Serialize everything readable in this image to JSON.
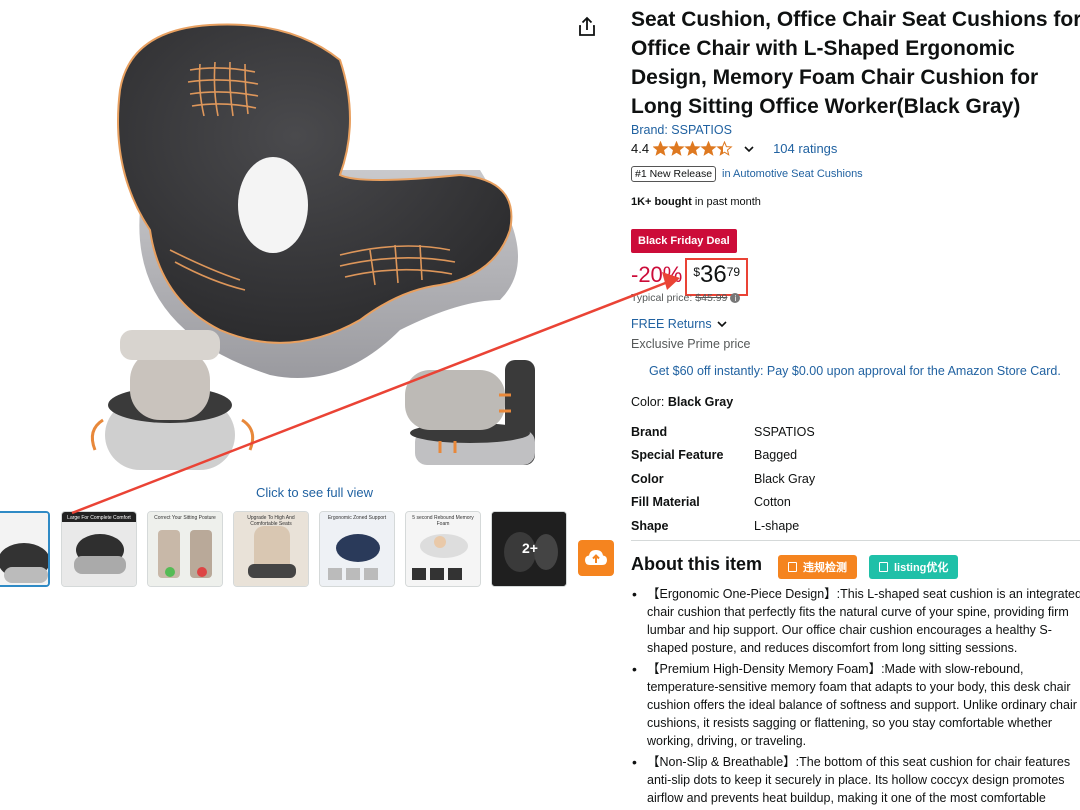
{
  "product": {
    "title": "Seat Cushion, Office Chair Seat Cushions for Office Chair with L-Shaped Ergonomic Design, Memory Foam Chair Cushion for Long Sitting Office Worker(Black Gray)",
    "brand_link": "Brand: SSPATIOS",
    "rating": "4.4",
    "stars": 4.4,
    "ratings_count": "104 ratings",
    "new_release_badge": "#1 New Release",
    "new_release_category": "in Automotive Seat Cushions",
    "bought_bold": "1K+ bought",
    "bought_rest": " in past month"
  },
  "pricing": {
    "deal_badge": "Black Friday Deal",
    "discount": "-20%",
    "currency": "$",
    "whole": "36",
    "fraction": "79",
    "typical_label": "Typical price:",
    "typical_value": "$45.99",
    "free_returns": "FREE Returns",
    "prime_price": "Exclusive Prime price",
    "store_card": "Get $60 off instantly: Pay $0.00 upon approval for the Amazon Store Card."
  },
  "color": {
    "label": "Color:",
    "value": "Black Gray"
  },
  "specs": [
    {
      "key": "Brand",
      "value": "SSPATIOS"
    },
    {
      "key": "Special Feature",
      "value": "Bagged"
    },
    {
      "key": "Color",
      "value": "Black Gray"
    },
    {
      "key": "Fill Material",
      "value": "Cotton"
    },
    {
      "key": "Shape",
      "value": "L-shape"
    }
  ],
  "gallery": {
    "click_full_view": "Click to see full view",
    "thumb_captions": [
      "",
      "Large For Complete Comfort",
      "Correct Your Sitting Posture",
      "Upgrade To High And Comfortable Seats",
      "Ergonomic Zoned Support",
      "5 second Rebound Memory Foam",
      ""
    ],
    "more_label": "2+"
  },
  "about": {
    "title": "About this item",
    "tool_violation": "违规检测",
    "tool_listing": "listing优化",
    "bullets": [
      "【Ergonomic One-Piece Design】:This L-shaped seat cushion is an integrated chair cushion that perfectly fits the natural curve of your spine, providing firm lumbar and hip support. Our office chair cushion encourages a healthy S-shaped posture, and reduces discomfort from long sitting sessions.",
      "【Premium High-Density Memory Foam】:Made with slow-rebound, temperature-sensitive memory foam that adapts to your body, this desk chair cushion offers the ideal balance of softness and support. Unlike ordinary chair cushions, it resists sagging or flattening, so you stay comfortable whether working, driving, or traveling.",
      "【Non-Slip & Breathable】:The bottom of this seat cushion for chair features anti-slip dots to keep it securely in place. Its hollow coccyx design promotes airflow and prevents heat buildup, making it one of the most comfortable"
    ]
  },
  "colors": {
    "link": "#2162a1",
    "deal_red": "#cc0c39",
    "star": "#de7921",
    "annotation_red": "#ea4335",
    "tool_orange": "#f5841f",
    "tool_teal": "#1fc0a8"
  }
}
